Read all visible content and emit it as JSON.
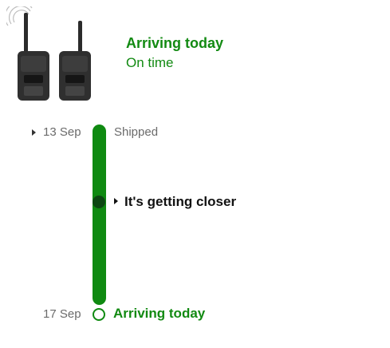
{
  "header": {
    "status_title": "Arriving today",
    "status_subtitle": "On time"
  },
  "product": {
    "image_label": "walkie-talkie-pair-image"
  },
  "timeline": {
    "events": [
      {
        "date": "13 Sep",
        "label": "Shipped"
      },
      {
        "date": "",
        "label": "It's getting closer"
      },
      {
        "date": "17 Sep",
        "label": "Arriving today"
      }
    ]
  },
  "colors": {
    "accent_green": "#128a12",
    "bar_green": "#0f8a11",
    "progress_dot": "#0c4712",
    "muted_text": "#6b6b6b"
  }
}
